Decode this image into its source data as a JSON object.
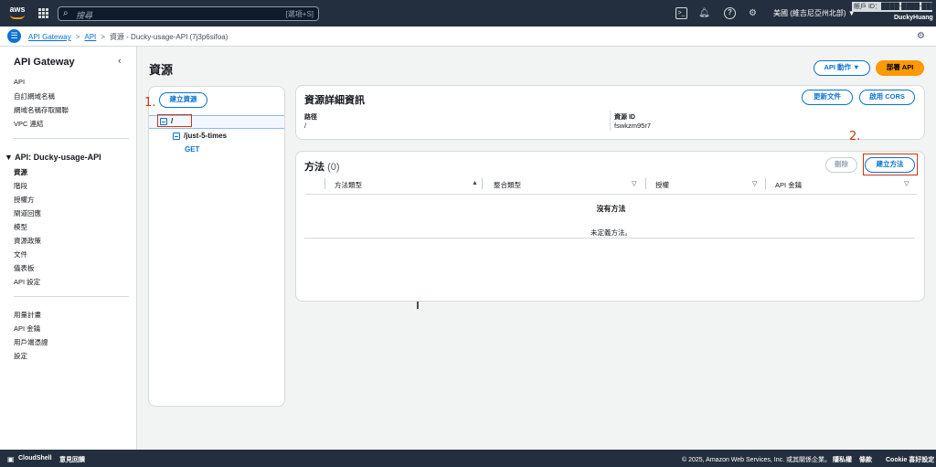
{
  "top_nav": {
    "logo_text": "aws",
    "search_placeholder": "搜尋",
    "search_shortcut": "[選項+S]",
    "region": "美國 (維吉尼亞州北部) ▼",
    "account_id": "帳戶 ID：████-████-████",
    "account_name": "DuckyHuang"
  },
  "breadcrumb": {
    "items": [
      "API Gateway",
      "API"
    ],
    "current": "資源 - Ducky-usage-API (7j3p6sifoa)"
  },
  "sidebar": {
    "title": "API Gateway",
    "top_items": [
      "API",
      "自訂網域名稱",
      "網域名稱存取關聯",
      "VPC 連結"
    ],
    "api_section": "API: Ducky-usage-API",
    "api_items": [
      "資源",
      "階段",
      "授權方",
      "閘道回應",
      "模型",
      "資源政策",
      "文件",
      "儀表板",
      "API 設定"
    ],
    "bottom_items": [
      "用量計畫",
      "API 金鑰",
      "用戶端憑證",
      "設定"
    ]
  },
  "page": {
    "title": "資源",
    "api_actions_label": "API 動作 ▼",
    "deploy_label": "部署 API"
  },
  "tree": {
    "create_resource_label": "建立資源",
    "root": "/",
    "child": "/just-5-times",
    "method": "GET"
  },
  "details": {
    "title": "資源詳細資訊",
    "update_docs_label": "更新文件",
    "enable_cors_label": "啟用 CORS",
    "path_label": "路徑",
    "path_value": "/",
    "id_label": "資源 ID",
    "id_value": "fswkzm95r7"
  },
  "methods": {
    "title": "方法",
    "count": "(0)",
    "delete_label": "刪除",
    "create_label": "建立方法",
    "columns": [
      "方法類型",
      "整合類型",
      "授權",
      "API 金鑰"
    ],
    "empty_title": "沒有方法",
    "empty_desc": "未定義方法。"
  },
  "annotations": {
    "step1": "1.",
    "step2": "2."
  },
  "footer": {
    "cloudshell": "CloudShell",
    "feedback": "意見回饋",
    "copyright": "© 2025, Amazon Web Services, Inc. 或其關係企業。",
    "privacy": "隱私權",
    "terms": "條款",
    "cookie": "Cookie 喜好設定"
  },
  "colors": {
    "nav_bg": "#232f3e",
    "link": "#0972d3",
    "primary": "#ff9900",
    "annotation": "#d13212"
  }
}
